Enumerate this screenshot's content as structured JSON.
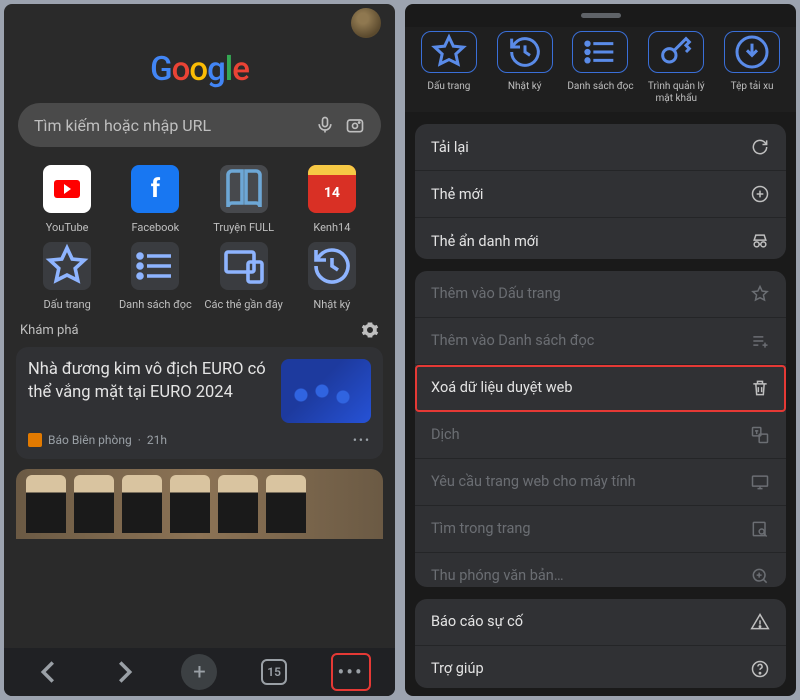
{
  "left": {
    "search_placeholder": "Tìm kiếm hoặc nhập URL",
    "shortcuts_row1": [
      {
        "label": "YouTube",
        "kind": "youtube"
      },
      {
        "label": "Facebook",
        "kind": "facebook"
      },
      {
        "label": "Truyện FULL",
        "kind": "book"
      },
      {
        "label": "Kenh14",
        "kind": "k14",
        "badge": "14"
      }
    ],
    "shortcuts_row2": [
      {
        "label": "Dấu trang",
        "icon": "star"
      },
      {
        "label": "Danh sách đọc",
        "icon": "list"
      },
      {
        "label": "Các thẻ gần đây",
        "icon": "devices"
      },
      {
        "label": "Nhật ký",
        "icon": "history"
      }
    ],
    "discover_label": "Khám phá",
    "news": {
      "title": "Nhà đương kim vô địch EURO có thể vắng mặt tại EURO 2024",
      "source": "Báo Biên phòng",
      "time": "21h"
    },
    "tab_count": "15"
  },
  "right": {
    "strip": [
      {
        "label": "Dấu trang",
        "icon": "star"
      },
      {
        "label": "Nhật ký",
        "icon": "history"
      },
      {
        "label": "Danh sách đọc",
        "icon": "list"
      },
      {
        "label": "Trình quản lý mật khẩu",
        "icon": "key"
      },
      {
        "label": "Tệp tải xu",
        "icon": "download"
      }
    ],
    "section1": [
      {
        "label": "Tải lại",
        "icon": "reload"
      },
      {
        "label": "Thẻ mới",
        "icon": "plus-circle"
      },
      {
        "label": "Thẻ ẩn danh mới",
        "icon": "incognito"
      }
    ],
    "section2": [
      {
        "label": "Thêm vào Dấu trang",
        "icon": "star",
        "disabled": true
      },
      {
        "label": "Thêm vào Danh sách đọc",
        "icon": "readlist",
        "disabled": true
      },
      {
        "label": "Xoá dữ liệu duyệt web",
        "icon": "trash",
        "disabled": false,
        "highlight": true
      },
      {
        "label": "Dịch",
        "icon": "translate",
        "disabled": true
      },
      {
        "label": "Yêu cầu trang web cho máy tính",
        "icon": "desktop",
        "disabled": true
      },
      {
        "label": "Tìm trong trang",
        "icon": "find",
        "disabled": true
      },
      {
        "label": "Thu phóng văn bản…",
        "icon": "zoom",
        "disabled": true
      }
    ],
    "section3": [
      {
        "label": "Báo cáo sự cố",
        "icon": "alert"
      },
      {
        "label": "Trợ giúp",
        "icon": "help"
      }
    ]
  }
}
